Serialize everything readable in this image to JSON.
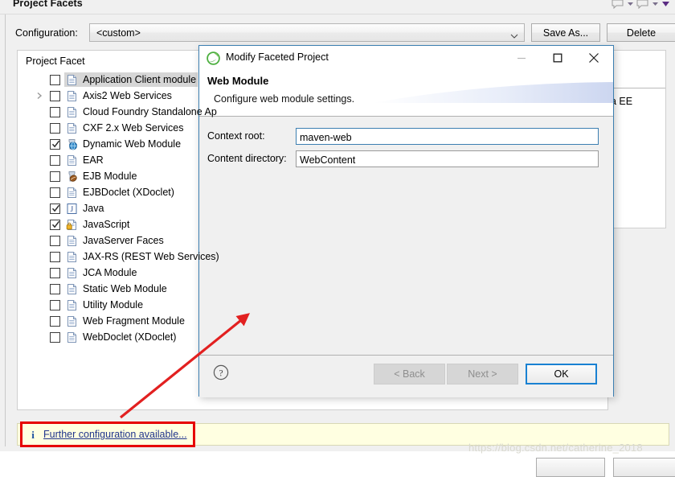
{
  "page": {
    "title": "Project Facets"
  },
  "toolbar": {
    "icons": [
      "balloon-icon",
      "chevron-down-icon",
      "balloon-icon",
      "chevron-down-icon",
      "chevron-down-filled-icon"
    ]
  },
  "configuration": {
    "label": "Configuration:",
    "value": "<custom>",
    "dropdown_icon": "chevron-down-icon",
    "save_as_label": "Save As...",
    "delete_label": "Delete"
  },
  "facet_tree": {
    "column_header": "Project Facet",
    "rows": [
      {
        "label": "Application Client module",
        "checked": false,
        "selected": true,
        "expandable": false,
        "icon": "document-icon"
      },
      {
        "label": "Axis2 Web Services",
        "checked": false,
        "selected": false,
        "expandable": true,
        "icon": "document-icon"
      },
      {
        "label": "Cloud Foundry Standalone Ap",
        "checked": false,
        "selected": false,
        "expandable": false,
        "icon": "document-icon"
      },
      {
        "label": "CXF 2.x Web Services",
        "checked": false,
        "selected": false,
        "expandable": false,
        "icon": "document-icon"
      },
      {
        "label": "Dynamic Web Module",
        "checked": true,
        "selected": false,
        "expandable": false,
        "icon": "globe-jar-icon"
      },
      {
        "label": "EAR",
        "checked": false,
        "selected": false,
        "expandable": false,
        "icon": "document-icon"
      },
      {
        "label": "EJB Module",
        "checked": false,
        "selected": false,
        "expandable": false,
        "icon": "bean-jar-icon"
      },
      {
        "label": "EJBDoclet (XDoclet)",
        "checked": false,
        "selected": false,
        "expandable": false,
        "icon": "document-icon"
      },
      {
        "label": "Java",
        "checked": true,
        "selected": false,
        "expandable": false,
        "icon": "java-icon"
      },
      {
        "label": "JavaScript",
        "checked": true,
        "selected": false,
        "expandable": false,
        "icon": "javascript-lock-icon"
      },
      {
        "label": "JavaServer Faces",
        "checked": false,
        "selected": false,
        "expandable": false,
        "icon": "document-icon"
      },
      {
        "label": "JAX-RS (REST Web Services)",
        "checked": false,
        "selected": false,
        "expandable": false,
        "icon": "document-icon"
      },
      {
        "label": "JCA Module",
        "checked": false,
        "selected": false,
        "expandable": false,
        "icon": "document-icon"
      },
      {
        "label": "Static Web Module",
        "checked": false,
        "selected": false,
        "expandable": false,
        "icon": "document-icon"
      },
      {
        "label": "Utility Module",
        "checked": false,
        "selected": false,
        "expandable": false,
        "icon": "document-icon"
      },
      {
        "label": "Web Fragment Module",
        "checked": false,
        "selected": false,
        "expandable": false,
        "icon": "document-icon"
      },
      {
        "label": "WebDoclet (XDoclet)",
        "checked": false,
        "selected": false,
        "expandable": false,
        "icon": "document-icon"
      }
    ]
  },
  "right_panel": {
    "text": "a EE"
  },
  "status_bar": {
    "info_icon": "info-icon",
    "link_text": "Further configuration available..."
  },
  "watermark": {
    "text": "https://blog.csdn.net/catherine_2018"
  },
  "dialog": {
    "app_icon": "spring-leaf-icon",
    "title": "Modify Faceted Project",
    "window_buttons": {
      "minimize": "minimize-icon",
      "maximize": "maximize-icon",
      "close": "close-icon"
    },
    "heading": "Web Module",
    "subheading": "Configure web module settings.",
    "fields": [
      {
        "label": "Context root:",
        "value": "maven-web",
        "focused": true
      },
      {
        "label": "Content directory:",
        "value": "WebContent",
        "focused": false
      }
    ],
    "footer": {
      "help_icon": "help-icon",
      "back_label": "< Back",
      "next_label": "Next >",
      "ok_label": "OK"
    }
  },
  "colors": {
    "accent_blue": "#1981d2",
    "dialog_border": "#3c7fb1",
    "annotation_red": "#e60000",
    "status_background": "#ffffe1",
    "link_blue": "#20348c"
  }
}
